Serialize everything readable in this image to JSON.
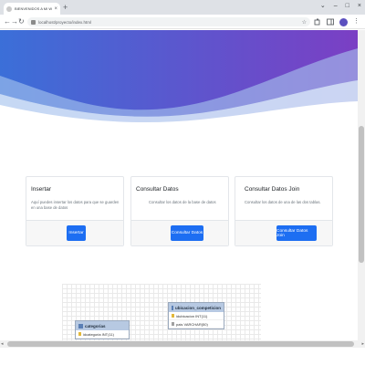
{
  "browser": {
    "tab_title": "BIENVENIDOS A MI WEB",
    "tab_close": "×",
    "new_tab": "+",
    "window_controls": [
      "⌄",
      "–",
      "□",
      "×"
    ],
    "nav": {
      "back": "←",
      "forward": "→",
      "reload": "↻"
    },
    "url": "localhost/proyecto/index.html",
    "bookmark_star": "☆",
    "menu_dots": "⋮"
  },
  "colors": {
    "hero_gradient": [
      "#3b6fd8",
      "#7b3fc4"
    ],
    "primary_button": "#1d6ef2"
  },
  "cards": [
    {
      "title": "Insertar",
      "text": "Aquí puedes insertar los datos para que se guarden en una base de datos",
      "button": "Insertar"
    },
    {
      "title": "Consultar Datos",
      "text": "Consultar los datos de la base de datos",
      "button": "Consultar Datos"
    },
    {
      "title": "Consultar Datos Join",
      "text": "Consultar los datos de una de las dos tablas.",
      "button": "Consultar Datos Join"
    }
  ],
  "diagram": {
    "tables": [
      {
        "name": "categorias",
        "columns": [
          "idcategoria INT(11)"
        ]
      },
      {
        "name": "ubicacion_competicion",
        "columns": [
          "idubicacion INT(11)",
          "pais VARCHAR(50)"
        ]
      }
    ]
  }
}
